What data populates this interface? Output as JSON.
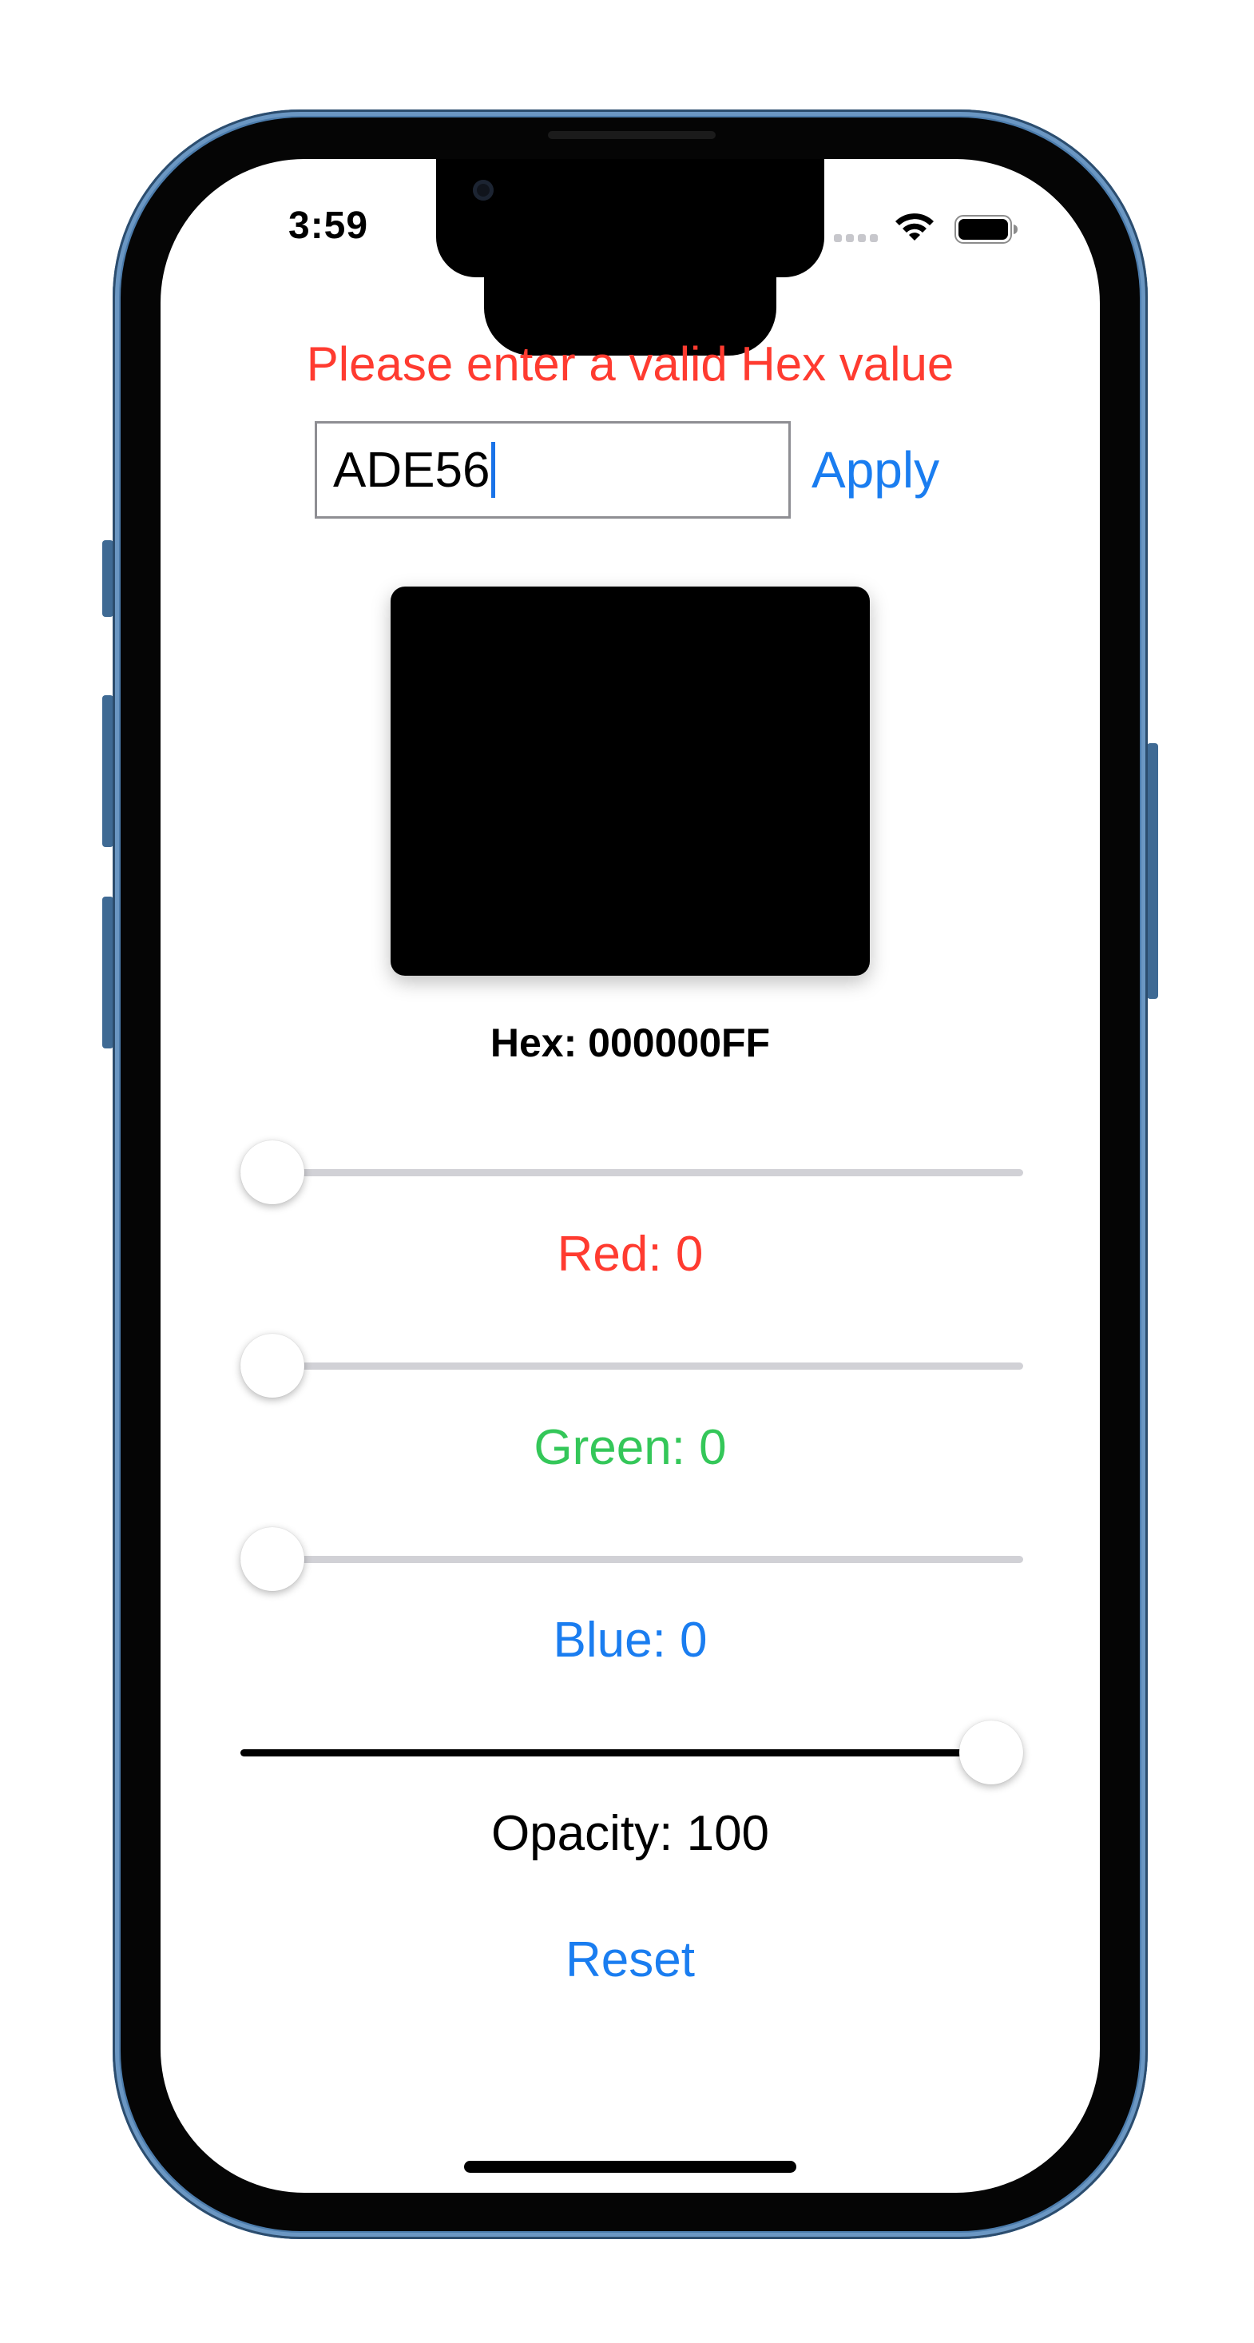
{
  "status_bar": {
    "time": "3:59"
  },
  "error_message": "Please enter a valid Hex value",
  "hex_input": {
    "value": "ADE56"
  },
  "apply_label": "Apply",
  "swatch_color": "#000000",
  "hex_display": "Hex: 000000FF",
  "sliders": [
    {
      "name": "red",
      "label": "Red: 0",
      "value": 0,
      "color": "#ff3b30"
    },
    {
      "name": "green",
      "label": "Green: 0",
      "value": 0,
      "color": "#34c759"
    },
    {
      "name": "blue",
      "label": "Blue: 0",
      "value": 0,
      "color": "#1a7df0"
    },
    {
      "name": "opacity",
      "label": "Opacity: 100",
      "value": 1,
      "color": "#000000"
    }
  ],
  "reset_label": "Reset"
}
